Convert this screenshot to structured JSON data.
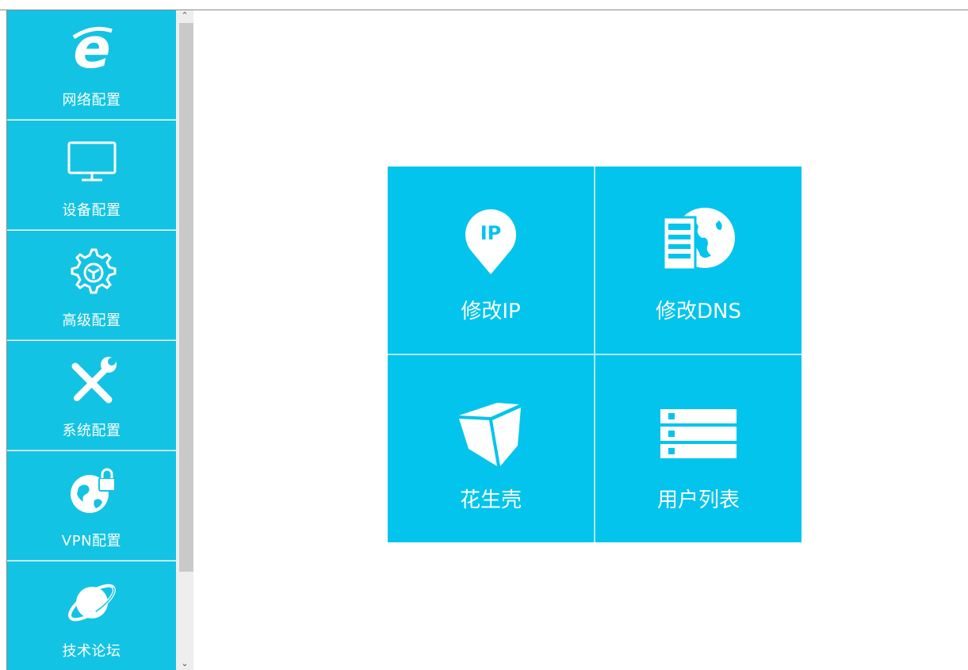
{
  "sidebar": {
    "items": [
      {
        "label": "网络配置",
        "icon": "ie-browser-icon"
      },
      {
        "label": "设备配置",
        "icon": "monitor-icon"
      },
      {
        "label": "高级配置",
        "icon": "gear-icon"
      },
      {
        "label": "系统配置",
        "icon": "tools-icon"
      },
      {
        "label": "VPN配置",
        "icon": "globe-lock-icon"
      },
      {
        "label": "技术论坛",
        "icon": "planet-icon"
      }
    ]
  },
  "tiles": [
    {
      "label": "修改IP",
      "icon": "ip-pin-icon",
      "icon_text": "IP"
    },
    {
      "label": "修改DNS",
      "icon": "dns-server-globe-icon"
    },
    {
      "label": "花生壳",
      "icon": "cube-icon"
    },
    {
      "label": "用户列表",
      "icon": "server-list-icon"
    }
  ],
  "colors": {
    "sidebar_bg": "#13c3e3",
    "tile_bg": "#03c4ec",
    "scrollbar_thumb": "#c9c9c9"
  }
}
